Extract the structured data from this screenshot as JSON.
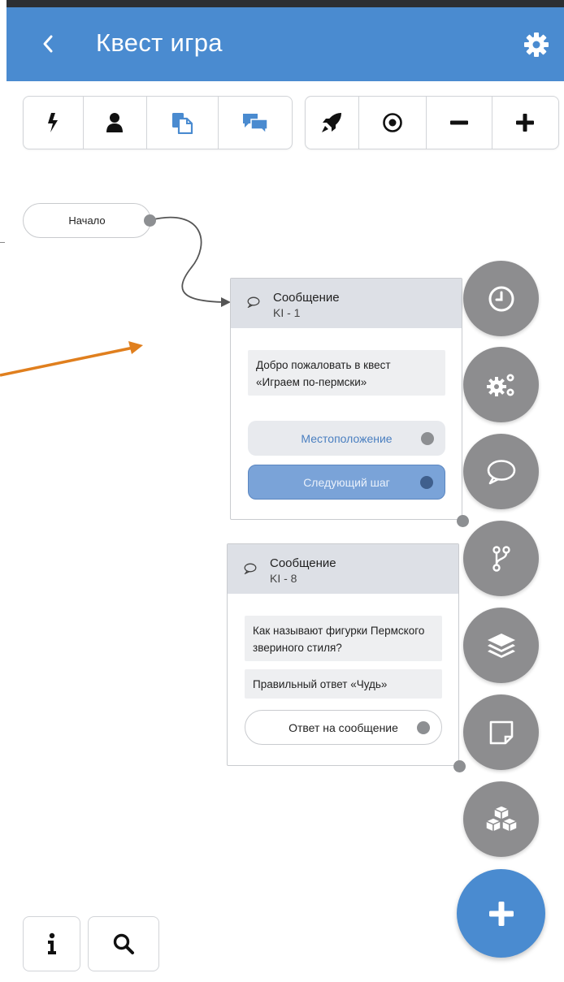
{
  "app": {
    "title": "Квест игра",
    "back_icon": "chevron-left-icon",
    "settings_icon": "gear-icon",
    "accent_color": "#4a8bd0"
  },
  "toolbar": {
    "left_group": [
      "lightning-icon",
      "user-icon",
      "copy-icon",
      "chat-bubbles-icon"
    ],
    "right_group": [
      "rocket-icon",
      "target-icon",
      "minus-icon",
      "plus-icon"
    ]
  },
  "start_node": {
    "label": "Начало"
  },
  "cards": [
    {
      "title": "Сообщение",
      "subtitle": "KI - 1",
      "messages": [
        "Добро пожаловать в квест «Играем по-пермски»"
      ],
      "answers": [
        {
          "label": "Местоположение",
          "style": "light"
        },
        {
          "label": "Следующий шаг",
          "style": "selected"
        }
      ]
    },
    {
      "title": "Сообщение",
      "subtitle": "KI - 8",
      "messages": [
        "Как называют фигурки Пермского звериного стиля?",
        "Правильный ответ «Чудь»"
      ],
      "answers": [
        {
          "label": "Ответ на сообщение",
          "style": "outline"
        }
      ]
    }
  ],
  "fabs": [
    "clock-icon",
    "gears-icon",
    "speech-bubble-icon",
    "branch-icon",
    "layers-icon",
    "note-icon",
    "cubes-icon",
    "plus-icon"
  ],
  "bottom_buttons": [
    "info-icon",
    "search-icon"
  ],
  "annotation_arrow_color": "#e07f1e"
}
